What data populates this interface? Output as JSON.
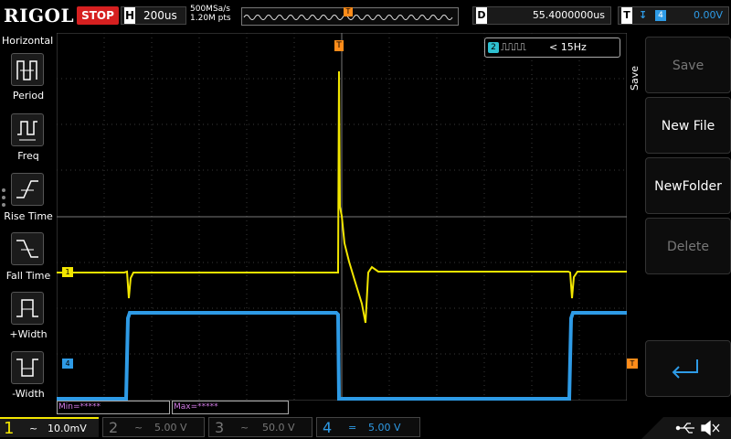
{
  "top": {
    "brand": "RIGOL",
    "run_state": "STOP",
    "h_label": "H",
    "timebase": "200us",
    "sample_rate": "500MSa/s",
    "points": "1.20M pts",
    "trigger_marker": "T",
    "d_label": "D",
    "delay": "55.4000000us",
    "t_label": "T",
    "trigger_slope": "↧",
    "trigger_source": "4",
    "trigger_level": "0.00V"
  },
  "left_menu": {
    "title": "Horizontal",
    "items": [
      {
        "label": "Period"
      },
      {
        "label": "Freq"
      },
      {
        "label": "Rise Time"
      },
      {
        "label": "Fall Time"
      },
      {
        "label": "+Width"
      },
      {
        "label": "-Width"
      }
    ]
  },
  "right_menu": {
    "title": "Save",
    "items": [
      {
        "label": "Save",
        "enabled": false
      },
      {
        "label": "New File",
        "enabled": true
      },
      {
        "label": "NewFolder",
        "enabled": true
      },
      {
        "label": "Delete",
        "enabled": false
      }
    ]
  },
  "measure": {
    "channel": "2",
    "waveform": "⎍⎍⎍⎍",
    "value": "< 15Hz"
  },
  "markers": {
    "ch1": "1",
    "ch4": "4",
    "trig_right": "T",
    "trig_top": "T"
  },
  "minmax": {
    "min": "Min=*****",
    "max": "Max=*****"
  },
  "channels": [
    {
      "num": "1",
      "coupling": "~",
      "scale": "10.0mV",
      "active": true,
      "color": "#f2e600"
    },
    {
      "num": "2",
      "coupling": "~",
      "scale": "5.00 V",
      "active": false,
      "color": "#777777"
    },
    {
      "num": "3",
      "coupling": "~",
      "scale": "50.0 V",
      "active": false,
      "color": "#777777"
    },
    {
      "num": "4",
      "coupling": "=",
      "scale": "5.00 V",
      "active": false,
      "color": "#2e9be6"
    }
  ],
  "status_icons": [
    "usb-icon",
    "speaker-muted-icon"
  ],
  "colors": {
    "ch1": "#f2e600",
    "ch4": "#2e9be6",
    "stop": "#d62020",
    "accent": "#ff8c1a"
  }
}
